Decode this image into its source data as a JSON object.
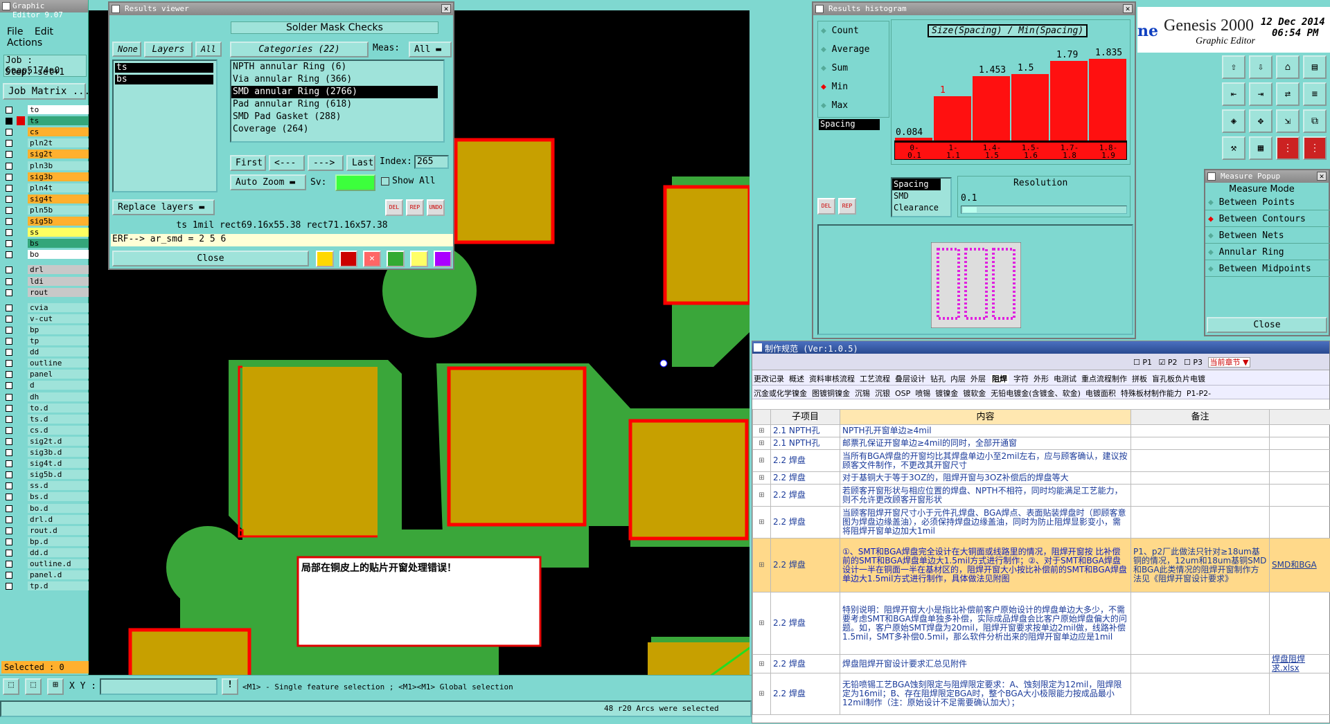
{
  "editor": {
    "title": "Graphic Editor 9.07",
    "menu": [
      "File",
      "Edit",
      "Actions"
    ],
    "job": "Job : 6aap5174a0",
    "step": "Step: set+1",
    "job_matrix": "Job Matrix ...",
    "selected": "Selected : 0",
    "xy_label": "X Y :",
    "hint": "<M1> - Single feature selection ; <M1><M1> Global selection",
    "status": "48 r20 Arcs were selected",
    "layers": [
      {
        "name": "to",
        "color": "#ffffff",
        "checked": false
      },
      {
        "name": "ts",
        "color": "#34a67a",
        "checked": true,
        "swatch": "#e00000"
      },
      {
        "name": "cs",
        "color": "#ffb02e",
        "checked": false
      },
      {
        "name": "pln2t",
        "color": "#9fe3da",
        "checked": false
      },
      {
        "name": "sig2t",
        "color": "#ffb02e",
        "checked": false
      },
      {
        "name": "pln3b",
        "color": "#9fe3da",
        "checked": false
      },
      {
        "name": "sig3b",
        "color": "#ffb02e",
        "checked": false
      },
      {
        "name": "pln4t",
        "color": "#9fe3da",
        "checked": false
      },
      {
        "name": "sig4t",
        "color": "#ffb02e",
        "checked": false
      },
      {
        "name": "pln5b",
        "color": "#9fe3da",
        "checked": false
      },
      {
        "name": "sig5b",
        "color": "#ffb02e",
        "checked": false
      },
      {
        "name": "ss",
        "color": "#ffff60",
        "checked": false
      },
      {
        "name": "bs",
        "color": "#34a67a",
        "checked": false
      },
      {
        "name": "bo",
        "color": "#ffffff",
        "checked": false
      },
      {
        "name": "drl",
        "color": "#c8c8c8",
        "checked": false
      },
      {
        "name": "ldi",
        "color": "#c8c8c8",
        "checked": false
      },
      {
        "name": "rout",
        "color": "#c8c8c8",
        "checked": false
      },
      {
        "name": "cvia",
        "color": "#9fe3da",
        "checked": false
      },
      {
        "name": "v-cut",
        "color": "#9fe3da",
        "checked": false
      },
      {
        "name": "bp",
        "color": "#9fe3da",
        "checked": false
      },
      {
        "name": "tp",
        "color": "#9fe3da",
        "checked": false
      },
      {
        "name": "dd",
        "color": "#9fe3da",
        "checked": false
      },
      {
        "name": "outline",
        "color": "#9fe3da",
        "checked": false
      },
      {
        "name": "panel",
        "color": "#9fe3da",
        "checked": false
      },
      {
        "name": "d",
        "color": "#9fe3da",
        "checked": false
      },
      {
        "name": "dh",
        "color": "#9fe3da",
        "checked": false
      },
      {
        "name": "to.d",
        "color": "#9fe3da",
        "checked": false
      },
      {
        "name": "ts.d",
        "color": "#9fe3da",
        "checked": false
      },
      {
        "name": "cs.d",
        "color": "#9fe3da",
        "checked": false
      },
      {
        "name": "sig2t.d",
        "color": "#9fe3da",
        "checked": false
      },
      {
        "name": "sig3b.d",
        "color": "#9fe3da",
        "checked": false
      },
      {
        "name": "sig4t.d",
        "color": "#9fe3da",
        "checked": false
      },
      {
        "name": "sig5b.d",
        "color": "#9fe3da",
        "checked": false
      },
      {
        "name": "ss.d",
        "color": "#9fe3da",
        "checked": false
      },
      {
        "name": "bs.d",
        "color": "#9fe3da",
        "checked": false
      },
      {
        "name": "bo.d",
        "color": "#9fe3da",
        "checked": false
      },
      {
        "name": "drl.d",
        "color": "#9fe3da",
        "checked": false
      },
      {
        "name": "rout.d",
        "color": "#9fe3da",
        "checked": false
      },
      {
        "name": "bp.d",
        "color": "#9fe3da",
        "checked": false
      },
      {
        "name": "dd.d",
        "color": "#9fe3da",
        "checked": false
      },
      {
        "name": "outline.d",
        "color": "#9fe3da",
        "checked": false
      },
      {
        "name": "panel.d",
        "color": "#9fe3da",
        "checked": false
      },
      {
        "name": "tp.d",
        "color": "#9fe3da",
        "checked": false
      }
    ]
  },
  "results_viewer": {
    "title": "Results viewer",
    "header": "Solder Mask Checks",
    "none": "None",
    "layers_label": "Layers",
    "all": "All",
    "categories_label": "Categories (22)",
    "meas_label": "Meas:",
    "meas_value": "All",
    "layers": [
      "ts",
      "bs"
    ],
    "categories": [
      "NPTH annular Ring (6)",
      "Via annular Ring (366)",
      "SMD annular Ring (2766)",
      "Pad annular Ring (618)",
      "SMD Pad Gasket (288)",
      "Coverage (264)"
    ],
    "selected_category": 2,
    "first": "First",
    "prev": "<---",
    "next": "--->",
    "last": "Last",
    "index_label": "Index:",
    "index_value": "265",
    "auto_zoom": "Auto Zoom",
    "sv_label": "Sv:",
    "show_all": "Show All",
    "replace_layers": "Replace layers",
    "icon_labels": [
      "DEL",
      "REP",
      "UNDO"
    ],
    "info_line": "ts 1mil   rect69.16x55.38   rect71.16x57.38",
    "erf_line": "ERF--> ar_smd = 2 5 6",
    "close": "Close"
  },
  "histogram": {
    "title": "Results histogram",
    "options": [
      "Count",
      "Average",
      "Sum",
      "Min",
      "Max"
    ],
    "selected_option": "Min",
    "header": "Size(Spacing) / Min(Spacing)",
    "left_label": "Spacing",
    "types": [
      "Spacing",
      "SMD",
      "Clearance"
    ],
    "resolution_label": "Resolution",
    "resolution_value": "0.1",
    "icon_labels": [
      "DEL",
      "REP"
    ]
  },
  "chart_data": {
    "type": "bar",
    "title": "Size(Spacing) / Min(Spacing)",
    "categories": [
      "0-0.1",
      "1-1.1",
      "1.4-1.5",
      "1.5-1.6",
      "1.7-1.8",
      "1.8-1.9"
    ],
    "values": [
      0.084,
      1,
      1.453,
      1.5,
      1.79,
      1.835
    ],
    "ylim": [
      0,
      2
    ]
  },
  "genesis": {
    "title": "Genesis 2000",
    "subtitle": "Graphic Editor",
    "date": "12 Dec 2014",
    "time": "06:54 PM"
  },
  "measure": {
    "title": "Measure Popup",
    "mode_label": "Measure Mode",
    "modes": [
      "Between Points",
      "Between Contours",
      "Between Nets",
      "Annular Ring",
      "Between Midpoints"
    ],
    "selected": 1,
    "close": "Close"
  },
  "callout": {
    "text": "局部在铜皮上的贴片开窗处理错误！"
  },
  "spec": {
    "title": "制作规范 (Ver:1.0.5)",
    "filters": [
      "P1",
      "P2",
      "P3"
    ],
    "chapter": "当前章节",
    "tabs1": [
      "更改记录",
      "概述",
      "资料审核流程",
      "工艺流程",
      "叠层设计",
      "钻孔",
      "内层",
      "外层",
      "阻焊",
      "字符",
      "外形",
      "电测试",
      "重点流程制作",
      "拼板",
      "盲孔板负片电镀"
    ],
    "tabs2": [
      "沉金或化学镍金",
      "图镀铜镍金",
      "沉锡",
      "沉银",
      "OSP",
      "喷锡",
      "镀镍金",
      "镀软金",
      "无铅电镀金(含镀金、软金)",
      "电镀面积",
      "特殊板材制作能力",
      "P1-P2-"
    ],
    "col_item": "子项目",
    "col_content": "内容",
    "col_note": "备注",
    "rows": [
      {
        "item": "2.1 NPTH孔",
        "content": "NPTH孔开窗单边≥4mil",
        "note": "",
        "extra": ""
      },
      {
        "item": "2.1 NPTH孔",
        "content": "邮票孔保证开窗单边≥4mil的同时，全部开通窗",
        "note": "",
        "extra": ""
      },
      {
        "item": "2.2 焊盘",
        "content": "当所有BGA焊盘的开窗均比其焊盘单边小至2mil左右，应与顾客确认，建议按顾客文件制作，不更改其开窗尺寸",
        "note": "",
        "extra": ""
      },
      {
        "item": "2.2 焊盘",
        "content": "对于基铜大于等于3OZ的，阻焊开窗与3OZ补偿后的焊盘等大",
        "note": "",
        "extra": ""
      },
      {
        "item": "2.2 焊盘",
        "content": "若顾客开窗形状与相应位置的焊盘、NPTH不相符，同时均能满足工艺能力，则不允许更改顾客开窗形状",
        "note": "",
        "extra": ""
      },
      {
        "item": "2.2 焊盘",
        "content": "当顾客阻焊开窗尺寸小于元件孔焊盘、BGA焊点、表面贴装焊盘时（即顾客意图为焊盘边缘盖油），必须保持焊盘边缘盖油，同时为防止阻焊显影变小，需将阻焊开窗单边加大1mil",
        "note": "",
        "extra": ""
      },
      {
        "item": "2.2 焊盘",
        "content": "①、SMT和BGA焊盘完全设计在大铜面或线路里的情况，阻焊开窗按 比补偿前的SMT和BGA焊盘单边大1.5mil方式进行制作；②、对于SMT和BGA焊盘设计一半在铜面一半在基材区的，阻焊开窗大小按比补偿前的SMT和BGA焊盘单边大1.5mil方式进行制作，具体做法见附图",
        "note": "P1、p2厂此做法只针对≥18um基铜的情况，12um和18um基铜SMD和BGA此类情况的阻焊开窗制作方法见《阻焊开窗设计要求》",
        "extra": "SMD和BGA"
      },
      {
        "item": "2.2 焊盘",
        "content": "特别说明：阻焊开窗大小是指比补偿前客户原始设计的焊盘单边大多少，不需要考虑SMT和BGA焊盘单独多补偿，实际成品焊盘会比客户原始焊盘偏大的问题。如，客户原始SMT焊盘为20mil，阻焊开窗要求按单边2mil做，线路补偿1.5mil，SMT多补偿0.5mil，那么软件分析出来的阻焊开窗单边应是1mil",
        "note": "",
        "extra": ""
      },
      {
        "item": "2.2 焊盘",
        "content": "焊盘阻焊开窗设计要求汇总见附件",
        "note": "",
        "extra": "焊盘阻焊求.xlsx"
      },
      {
        "item": "2.2 焊盘",
        "content": "无铅喷锡工艺BGA蚀刻限定与阻焊限定要求：A、蚀刻限定为12mil，阻焊限定为16mil；B、存在阻焊限定BGA时，整个BGA大小极限能力按成品最小12mil制作（注：原始设计不足需要确认加大）；",
        "note": "",
        "extra": ""
      }
    ]
  }
}
